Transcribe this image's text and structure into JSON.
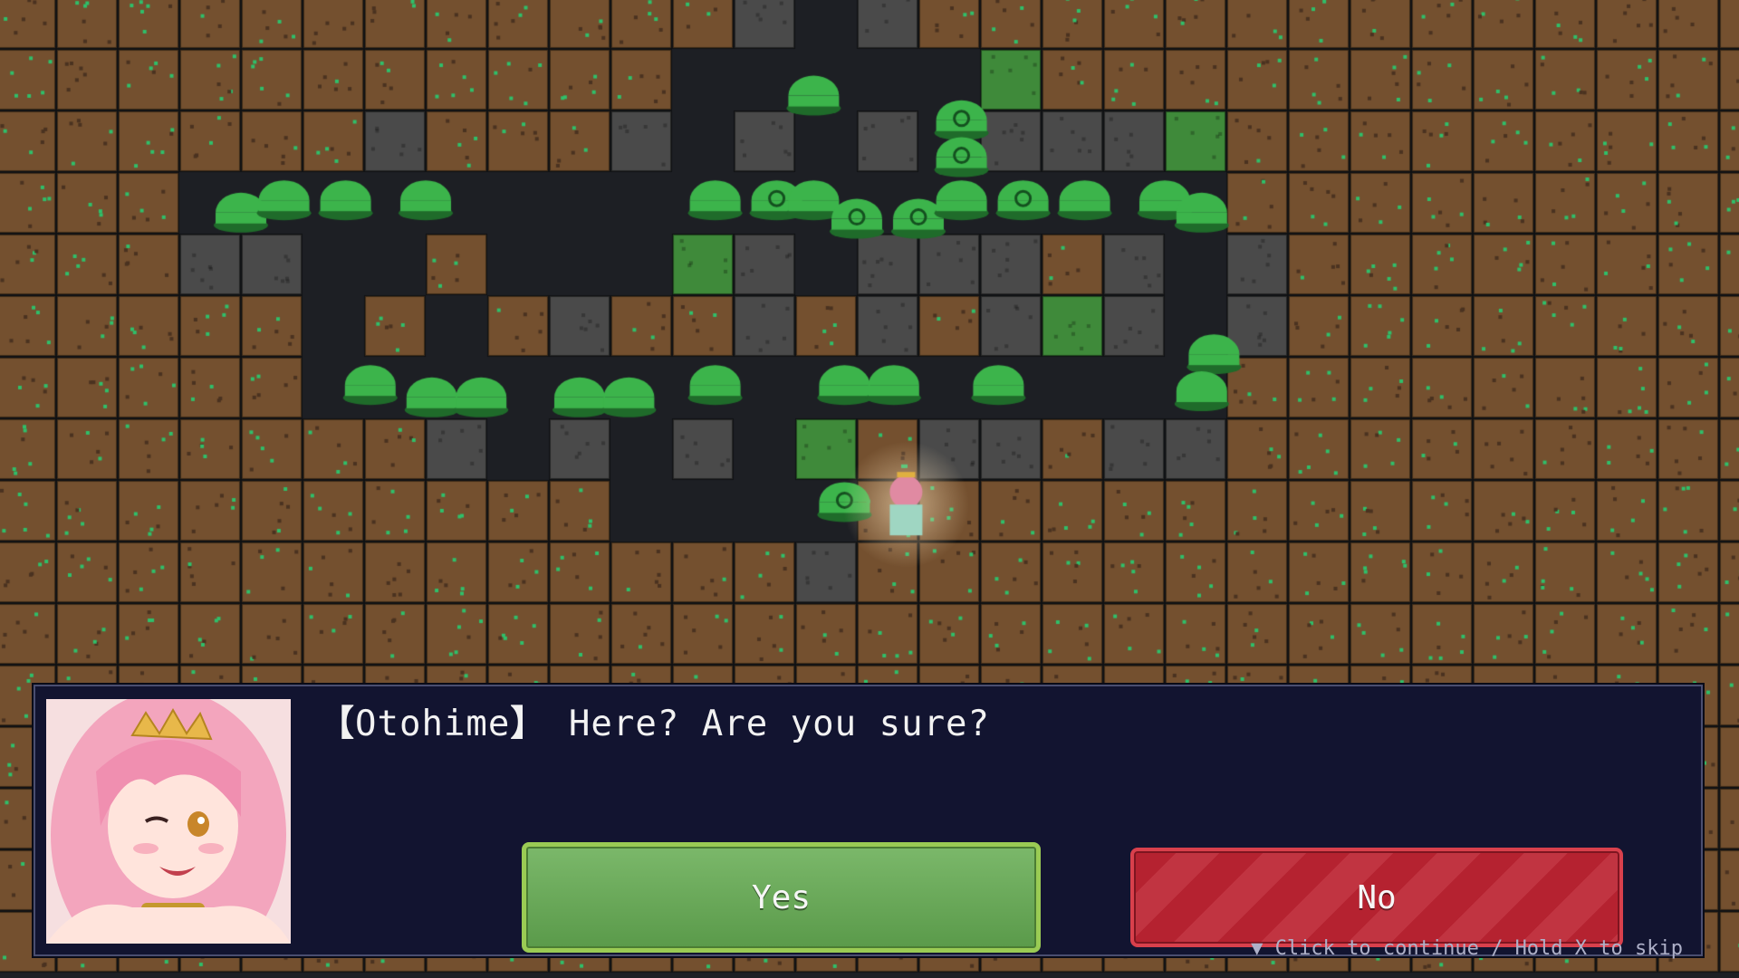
{
  "dialog": {
    "speaker_bracket_open": "【",
    "speaker": "Otohime",
    "speaker_bracket_close": "】",
    "message": "Here? Are you sure?",
    "choices": {
      "yes": "Yes",
      "no": "No"
    },
    "hint": "▼ Click to continue / Hold X to skip"
  },
  "colors": {
    "dirt": "#74502f",
    "stone": "#4a4a4a",
    "moss": "#3f8a3a",
    "floor": "#1d1f24",
    "slime": "#3cb44b",
    "dialog_bg": "#121430",
    "yes_green": "#6aa95a",
    "no_red": "#bb2a37"
  },
  "map": {
    "tiles": [
      "DDDDDDDDDDDDSFSDDDDDDDDDDDDDDD",
      "DDDDDDDDDDDFFFFFMDDDDDDDDDDDDD",
      "DDDDDDSDDDSFSFSFSSSMDDDDDDDDDD",
      "DDDFFFFFFFFFFFFFFFFFDDDDDDDDDD",
      "DDDSSFFDFFFMSFSSSDSFSDDDDDDDDD",
      "DDDDDFDFDSDDSDSDSMSFSDDDDDDDDD",
      "DDDDDFFFFFFFFFFFFFFFDDDDDDDDDD",
      "DDDDDDDSFSFSFMDSSDSSDDDDDDDDDD",
      "DDDDDDDDDDFFFFDDDDDDDDDDDDDDDD",
      "DDDDDDDDDDDDDSDDDDDDDDDDDDDDDD",
      "DDDDDDDDDDDDDDDDDDDDDDDDDDDDDD",
      "DDDDDDDDDDDDDDDDDDDDDDDDDDDDDD",
      "DDDDDDDDDDDDDDDDDDDDDDDDDDDDDD",
      "DDDDDDDDDDDDDDDDDDDDDDDDDDDDDD",
      "DDDDDDDDDDDDDDDDDDDDDDDDDDDDDD",
      "DDDDDDDDDDDDDDDDDDDDDDDDDDDDDD"
    ],
    "slimes": [
      {
        "col": 12.8,
        "row": 1.2,
        "eye": false
      },
      {
        "col": 15.2,
        "row": 1.6,
        "eye": true
      },
      {
        "col": 15.2,
        "row": 2.2,
        "eye": true
      },
      {
        "col": 3.5,
        "row": 3.1,
        "eye": false
      },
      {
        "col": 4.2,
        "row": 2.9,
        "eye": false
      },
      {
        "col": 5.2,
        "row": 2.9,
        "eye": false
      },
      {
        "col": 6.5,
        "row": 2.9,
        "eye": false
      },
      {
        "col": 11.2,
        "row": 2.9,
        "eye": false
      },
      {
        "col": 12.2,
        "row": 2.9,
        "eye": true
      },
      {
        "col": 12.8,
        "row": 2.9,
        "eye": false
      },
      {
        "col": 13.5,
        "row": 3.2,
        "eye": true
      },
      {
        "col": 14.5,
        "row": 3.2,
        "eye": true
      },
      {
        "col": 15.2,
        "row": 2.9,
        "eye": false
      },
      {
        "col": 16.2,
        "row": 2.9,
        "eye": true
      },
      {
        "col": 17.2,
        "row": 2.9,
        "eye": false
      },
      {
        "col": 18.5,
        "row": 2.9,
        "eye": false
      },
      {
        "col": 19.1,
        "row": 3.1,
        "eye": false
      },
      {
        "col": 19.3,
        "row": 5.4,
        "eye": false
      },
      {
        "col": 5.6,
        "row": 5.9,
        "eye": false
      },
      {
        "col": 6.6,
        "row": 6.1,
        "eye": false
      },
      {
        "col": 7.4,
        "row": 6.1,
        "eye": false
      },
      {
        "col": 9.0,
        "row": 6.1,
        "eye": false
      },
      {
        "col": 9.8,
        "row": 6.1,
        "eye": false
      },
      {
        "col": 11.2,
        "row": 5.9,
        "eye": false
      },
      {
        "col": 13.3,
        "row": 5.9,
        "eye": false
      },
      {
        "col": 14.1,
        "row": 5.9,
        "eye": false
      },
      {
        "col": 15.8,
        "row": 5.9,
        "eye": false
      },
      {
        "col": 19.1,
        "row": 6.0,
        "eye": false
      },
      {
        "col": 13.3,
        "row": 7.8,
        "eye": true
      }
    ],
    "player": {
      "col": 14.3,
      "row": 7.9
    }
  }
}
